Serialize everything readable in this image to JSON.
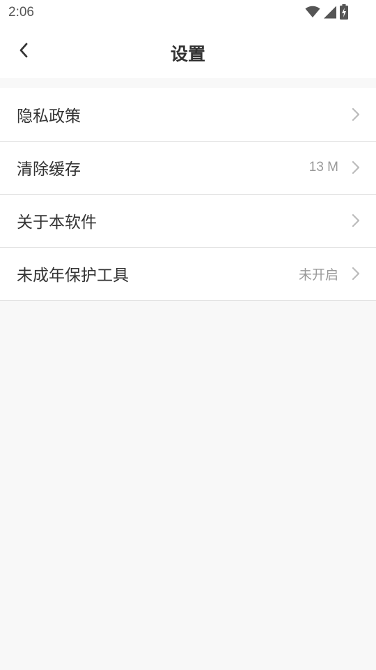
{
  "status_bar": {
    "time": "2:06",
    "icons": [
      "wifi-icon",
      "cellular-signal-icon",
      "battery-charging-icon"
    ]
  },
  "header": {
    "title": "设置",
    "back_icon": "chevron-left-icon"
  },
  "settings": {
    "items": [
      {
        "label": "隐私政策",
        "value": ""
      },
      {
        "label": "清除缓存",
        "value": "13 M"
      },
      {
        "label": "关于本软件",
        "value": ""
      },
      {
        "label": "未成年保护工具",
        "value": "未开启"
      }
    ]
  },
  "colors": {
    "background": "#f8f8f8",
    "surface": "#ffffff",
    "text_primary": "#333333",
    "text_secondary": "#999999",
    "divider": "#e3e3e3",
    "chevron": "#bbbbbb"
  }
}
